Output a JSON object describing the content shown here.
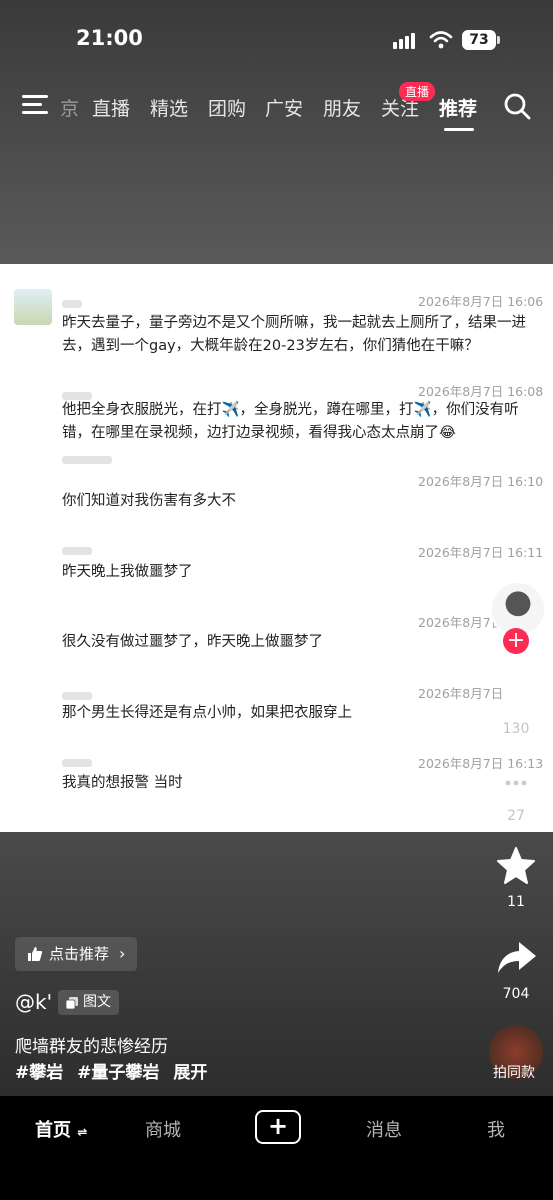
{
  "status_bar": {
    "time": "21:00",
    "battery": "73"
  },
  "top_tabs": [
    {
      "label": "京"
    },
    {
      "label": "直播"
    },
    {
      "label": "精选"
    },
    {
      "label": "团购"
    },
    {
      "label": "广安"
    },
    {
      "label": "朋友"
    },
    {
      "label": "关注"
    },
    {
      "label": "推荐"
    }
  ],
  "live_badge": "直播",
  "chat": [
    {
      "time": "2026年8月7日 16:06",
      "text": "昨天去量子，量子旁边不是又个厕所嘛，我一起就去上厕所了，结果一进去，遇到一个gay，大概年龄在20-23岁左右，你们猜他在干嘛？"
    },
    {
      "time": "2026年8月7日 16:08",
      "text": "他把全身衣服脱光，在打✈️，全身脱光，蹲在哪里，打✈️，你们没有听错，在哪里在录视频，边打边录视频，看得我心态太点崩了😂"
    },
    {
      "time": "2026年8月7日 16:10",
      "text": "你们知道对我伤害有多大不"
    },
    {
      "time": "2026年8月7日 16:11",
      "text": "昨天晚上我做噩梦了"
    },
    {
      "time": "2026年8月7日",
      "text": "很久没有做过噩梦了，昨天晚上做噩梦了"
    },
    {
      "time": "2026年8月7日",
      "text": "那个男生长得还是有点小帅，如果把衣服穿上"
    },
    {
      "time": "2026年8月7日 16:13",
      "text": "我真的想报警 当时"
    }
  ],
  "rail": {
    "like_count": "130",
    "comment_count": "27",
    "favorite_count": "11",
    "share_count": "704",
    "music_label": "拍同款"
  },
  "post": {
    "recommend": "点击推荐",
    "author": "@k'",
    "type": "图文",
    "description": "爬墙群友的悲惨经历",
    "tags": [
      "#攀岩",
      "#量子攀岩"
    ],
    "expand": "展开"
  },
  "bottom_nav": {
    "home": "首页",
    "shop": "商城",
    "messages": "消息",
    "me": "我"
  }
}
